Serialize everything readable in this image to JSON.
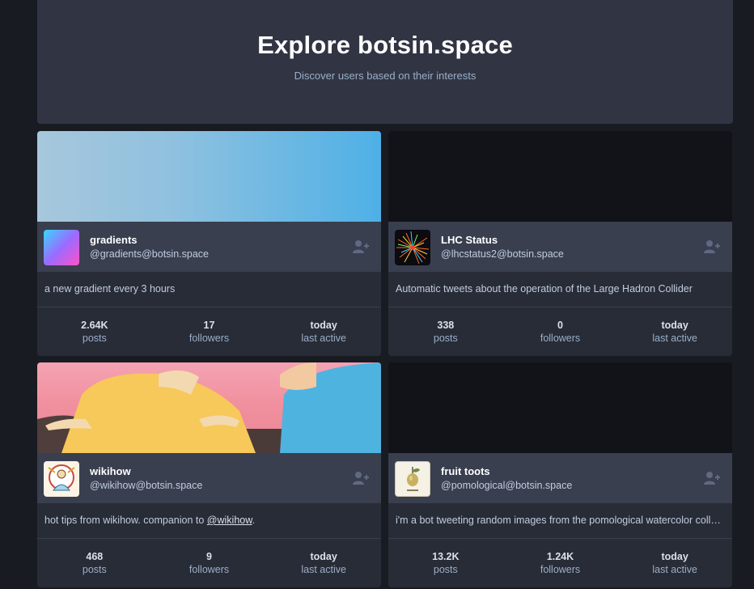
{
  "hero": {
    "title": "Explore botsin.space",
    "subtitle": "Discover users based on their interests"
  },
  "cards": [
    {
      "display_name": "gradients",
      "acct": "@gradients@botsin.space",
      "bio": "a new gradient every 3 hours",
      "stats": [
        {
          "value": "2.64K",
          "label": "posts"
        },
        {
          "value": "17",
          "label": "followers"
        },
        {
          "value": "today",
          "label": "last active"
        }
      ]
    },
    {
      "display_name": "LHC Status",
      "acct": "@lhcstatus2@botsin.space",
      "bio": "Automatic tweets about the operation of the Large Hadron Collider",
      "stats": [
        {
          "value": "338",
          "label": "posts"
        },
        {
          "value": "0",
          "label": "followers"
        },
        {
          "value": "today",
          "label": "last active"
        }
      ]
    },
    {
      "display_name": "wikihow",
      "acct": "@wikihow@botsin.space",
      "bio_prefix": "hot tips from wikihow. companion to ",
      "bio_link": "@wikihow",
      "bio_suffix": ".",
      "stats": [
        {
          "value": "468",
          "label": "posts"
        },
        {
          "value": "9",
          "label": "followers"
        },
        {
          "value": "today",
          "label": "last active"
        }
      ]
    },
    {
      "display_name": "fruit toots",
      "acct": "@pomological@botsin.space",
      "bio": "i'm a bot tweeting random images from the pomological watercolor collection",
      "stats": [
        {
          "value": "13.2K",
          "label": "posts"
        },
        {
          "value": "1.24K",
          "label": "followers"
        },
        {
          "value": "today",
          "label": "last active"
        }
      ]
    }
  ],
  "icons": {
    "follow": "user-plus-icon"
  },
  "colors": {
    "background": "#191b22",
    "card": "#282c37",
    "bar": "#393f4f",
    "hero": "#313543"
  }
}
